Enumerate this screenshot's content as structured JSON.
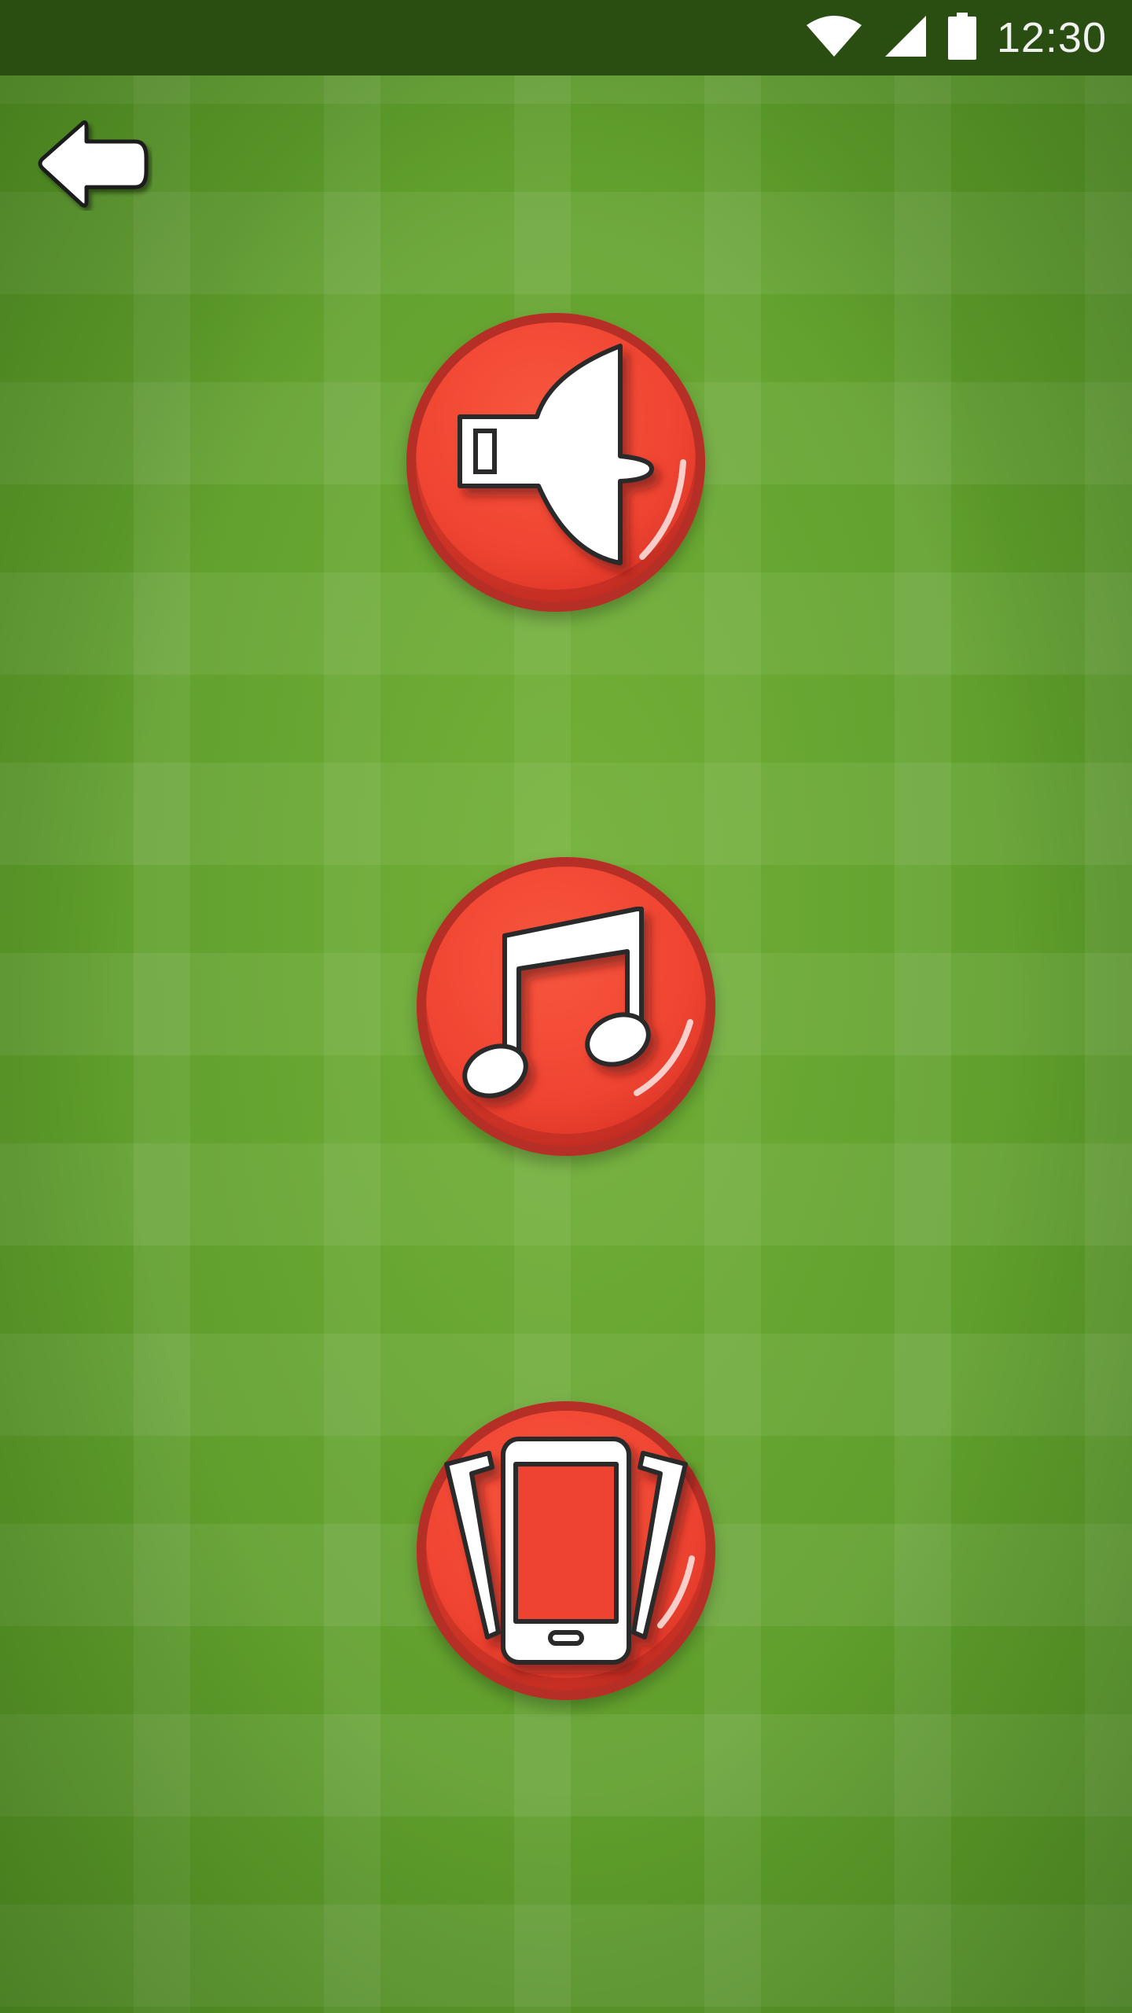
{
  "status_bar": {
    "time": "12:30",
    "icons": [
      "wifi-icon",
      "cell-signal-icon",
      "battery-icon"
    ]
  },
  "navigation": {
    "back_icon": "back-arrow-icon"
  },
  "settings_buttons": [
    {
      "name": "sound",
      "icon": "whistle-icon"
    },
    {
      "name": "music",
      "icon": "music-note-icon"
    },
    {
      "name": "vibration",
      "icon": "vibrate-phone-icon"
    }
  ],
  "colors": {
    "status_bar": "#2a4d12",
    "field_green": "#5f9e2c",
    "button_red": "#ef4431",
    "button_rim": "#b62f27",
    "icon_white": "#ffffff"
  }
}
